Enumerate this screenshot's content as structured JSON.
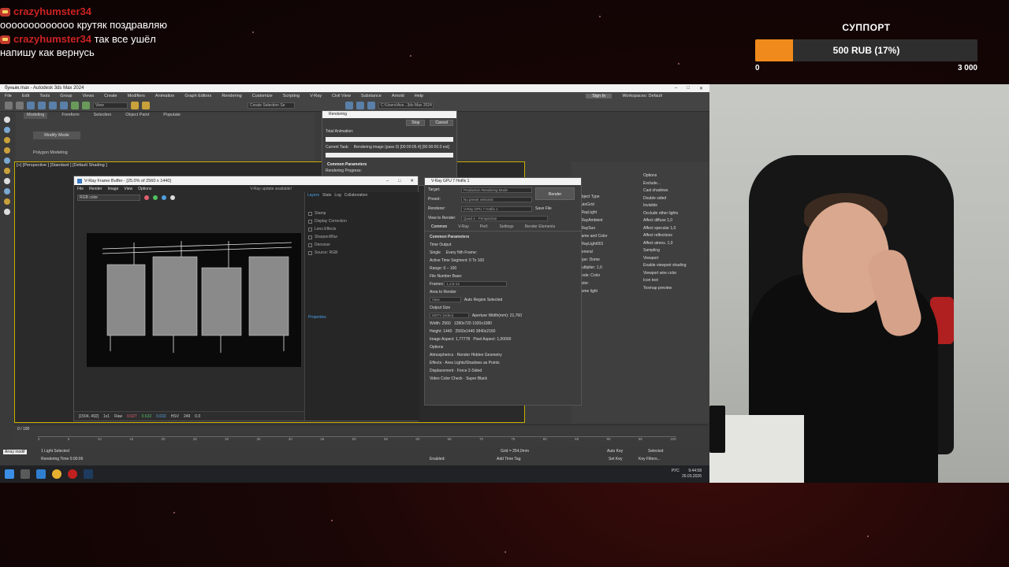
{
  "chat": {
    "messages": [
      {
        "user": "crazyhumster34",
        "text": "ооооооооооооо крутяк поздравляю"
      },
      {
        "user": "crazyhumster34",
        "text": "так все ушёл напишу как вернусь"
      }
    ]
  },
  "donation": {
    "title": "СУППОРТ",
    "amount": "500 RUB (17%)",
    "progress_fraction": 0.17,
    "min": "0",
    "max": "3 000",
    "fill_color": "#f08a1c"
  },
  "app": {
    "title": "буным.max - Autodesk 3ds Max 2024",
    "menu": [
      "File",
      "Edit",
      "Tools",
      "Group",
      "Views",
      "Create",
      "Modifiers",
      "Animation",
      "Graph Editors",
      "Rendering",
      "Customize",
      "Scripting",
      "V-Ray",
      "Civil View",
      "Substance",
      "Arnold",
      "Help"
    ],
    "sign_in": "Sign In",
    "workspace": "Workspaces:  Default",
    "view_select": "View",
    "create_selection": "Create Selection Se",
    "path": "C:\\Users\\Ave...3ds Max 2024",
    "ribbon_tabs": [
      "Modeling",
      "Freeform",
      "Selection",
      "Object Paint",
      "Populate"
    ],
    "modify_mode": "Modify Mode",
    "polygon_modeling": "Polygon Modeling",
    "viewport_label": "[+] [Perspective ] [Standard ] [Default Shading ]"
  },
  "vfb": {
    "title": "V-Ray Frame Buffer - [25.0% of 2560 x 1440]",
    "menu": [
      "File",
      "Render",
      "Image",
      "View",
      "Options"
    ],
    "update": "V-Ray update available!",
    "channel": "RGB color",
    "side_tabs": [
      "Layers",
      "Stats",
      "Log",
      "Collaboration"
    ],
    "layers": [
      "Stamp",
      "Display Correction",
      "Lens Effects",
      "Sharpen/Blur",
      "Denoiser",
      "Source: RGB"
    ],
    "properties": "Properties",
    "status": {
      "coords": "[1504, 492]",
      "zoom": "1x1",
      "mode": "Raw",
      "r": "0.627",
      "g": "0.632",
      "b": "0.632",
      "hsv": "HSV",
      "h": "249",
      "v": "0.0"
    }
  },
  "rendering": {
    "title": "Rendering",
    "stop": "Stop",
    "cancel": "Cancel",
    "total_animation": "Total Animation:",
    "current_task_label": "Current Task:",
    "current_task": "Rendering image (pass 0) [00:00:05.4] [00:00:00.0 est]",
    "common_params": "Common Parameters",
    "rendering_progress": "Rendering Progress:"
  },
  "render_setup": {
    "title": "V-Ray GPU 7 Hotfix 1",
    "target_label": "Target:",
    "target": "Production Rendering Mode",
    "preset_label": "Preset:",
    "preset": "No preset selected",
    "renderer_label": "Renderer:",
    "renderer": "V-Ray GPU 7 Hotfix 1",
    "save_file": "Save File",
    "view_label": "View to Render:",
    "view": "Quad 4 - Perspective",
    "render_btn": "Render",
    "tabs": [
      "Common",
      "V-Ray",
      "Perf.",
      "Settings",
      "Render Elements"
    ],
    "section": "Common Parameters",
    "time_output": "Time Output",
    "single": "Single",
    "every_nth": "Every Nth Frame:",
    "active_segment": "Active Time Segment:",
    "active_segment_value": "0 To 100",
    "range": "Range:",
    "range_from": "0",
    "range_to": "100",
    "file_number_base": "File Number Base:",
    "frames": "Frames",
    "frames_value": "1,3,5-12",
    "area_to_render": "Area to Render",
    "area_value": "View",
    "auto_region": "Auto Region Selected",
    "output_size": "Output Size",
    "output_preset": "HDTV (video)",
    "aperture": "Aperture Width(mm): 21,760",
    "width_label": "Width:",
    "width": "2560",
    "height_label": "Height:",
    "height": "1440",
    "sizes": [
      "1280x720",
      "1920x1080",
      "2560x1440",
      "3840x2160"
    ],
    "image_aspect": "Image Aspect: 1,77778",
    "pixel_aspect": "Pixel Aspect:",
    "pixel_aspect_value": "1,00000",
    "options": "Options",
    "opts": [
      "Atmospherics",
      "Render Hidden Geometry",
      "Effects",
      "Area Lights/Shadows as Points",
      "Displacement",
      "Force 2-Sided",
      "Video Color Check",
      "Super Black"
    ]
  },
  "command_panel": {
    "options": "Options",
    "exclude": "Exclude...",
    "col_right": [
      "Cast shadows",
      "Double sided",
      "Invisible",
      "Occlude other lights",
      "Affect diffuse  1,0",
      "Affect specular  1,0",
      "Affect reflections",
      "Affect atmos.  1,0"
    ],
    "sampling": "Sampling",
    "viewport": "Viewport",
    "viewport_items": [
      "Enable viewport shading",
      "Viewport wire color",
      "Icon text",
      "Texmap preview"
    ],
    "col_left": [
      "Object Type",
      "AutoGrid",
      "VRayLight",
      "VRayAmbient",
      "VRaySun",
      "Name and Color",
      "VRayLight001",
      "General",
      "Type: Dome",
      "Multiplier: 1,0",
      "Mode: Color",
      "Color:",
      "Dome light"
    ]
  },
  "timeline": {
    "counter": "0 / 100",
    "ticks": [
      "0",
      "5",
      "10",
      "15",
      "20",
      "25",
      "30",
      "35",
      "40",
      "45",
      "50",
      "55",
      "60",
      "65",
      "70",
      "75",
      "80",
      "85",
      "90",
      "95",
      "100"
    ]
  },
  "status": {
    "script": "Array modif",
    "selected": "1 Light Selected",
    "render_time": "Rendering Time  0:00:06",
    "grid": "Grid = 254,0mm",
    "add_time_tag": "Add Time Tag",
    "auto_key": "Auto Key",
    "selected_dd": "Selected",
    "set_key": "Set Key",
    "key_filters": "Key Filters...",
    "enabled": "Enabled:"
  },
  "taskbar": {
    "time": "9:44:58",
    "date": "26.03.2026",
    "lang": "РУС"
  }
}
